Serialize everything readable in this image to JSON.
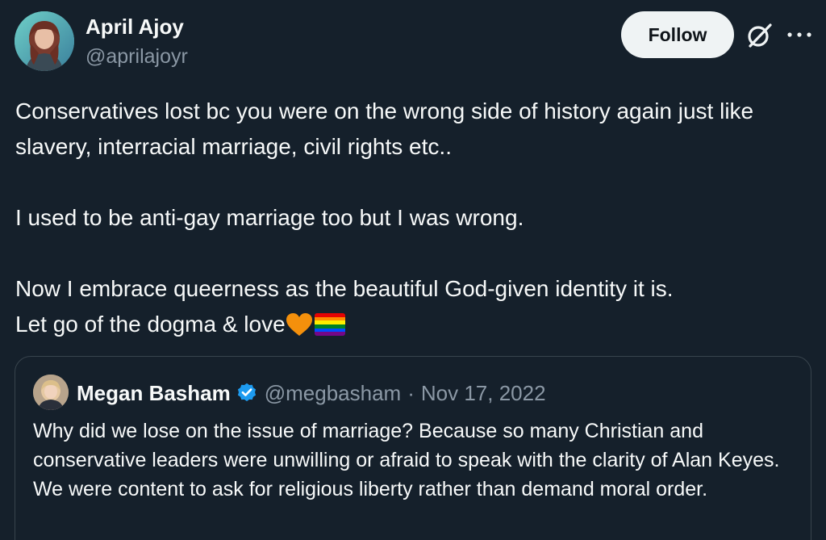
{
  "author": {
    "name": "April Ajoy",
    "handle": "@aprilajoyr",
    "avatar_icon": "profile-photo"
  },
  "header_actions": {
    "follow_label": "Follow",
    "grok_icon": "grok-icon",
    "more_icon": "more-horizontal-icon"
  },
  "tweet": {
    "paragraphs": [
      "Conservatives lost bc you were on the wrong side of history again just like slavery, interracial marriage, civil rights etc..",
      "",
      "I used to be anti-gay marriage too but I was wrong.",
      "",
      "Now I embrace queerness as the beautiful God-given identity it is.",
      "Let go of the dogma & love"
    ],
    "emojis": [
      "orange-heart-emoji",
      "rainbow-flag-emoji"
    ]
  },
  "quote": {
    "name": "Megan Basham",
    "handle": "@megbasham",
    "separator": "·",
    "date": "Nov 17, 2022",
    "verified": true,
    "text": "Why did we lose on the issue of marriage? Because so many Christian and conservative leaders were unwilling or afraid to speak with the clarity of Alan Keyes. We were content to ask for religious liberty rather than demand moral order."
  },
  "colors": {
    "background": "#15202b",
    "text_primary": "#f7f9f9",
    "text_secondary": "#8b98a5",
    "verified_blue": "#1d9bf0",
    "border": "#38444d",
    "follow_bg": "#eff3f4"
  }
}
